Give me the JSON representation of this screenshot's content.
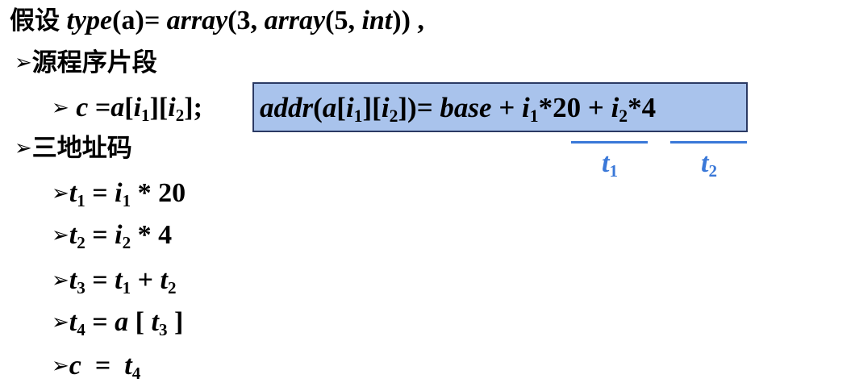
{
  "header": {
    "prefix": "假设",
    "type_fn": "type",
    "arg": "(a)",
    "eq_array": "= array",
    "mid": "(3, ",
    "array2": "array",
    "mid2": "(5, ",
    "int_kw": "int",
    "tail": ")) ,"
  },
  "source_section": {
    "arrow": "➢",
    "heading": "源程序片段"
  },
  "statement": {
    "arrow": "➢",
    "c": "c",
    "eq": " =",
    "a": "a",
    "ob1": "[",
    "i": "i",
    "sub1": "1",
    "cb_ob": "][",
    "i2": "i",
    "sub2": "2",
    "close": "];"
  },
  "formula": {
    "addr": "addr",
    "p1": "(",
    "a": "a",
    "b1": "[",
    "i": "i",
    "s1": "1",
    "b2": "][",
    "i2": "i",
    "s2": "2",
    "b3": "])= ",
    "base": "base",
    "plus1": " + ",
    "i3": "i",
    "s3": "1",
    "times20": "*20 + ",
    "i4": "i",
    "s4": "2",
    "times4": "*4"
  },
  "annotations": {
    "t1_var": "t",
    "t1_sub": "1",
    "t2_var": "t",
    "t2_sub": "2",
    "color": "#3a78d8"
  },
  "tac_section": {
    "arrow": "➢",
    "heading": "三地址码"
  },
  "tac": {
    "arrow": "➢",
    "line1": {
      "t": "t",
      "ts": "1",
      "eq": " = ",
      "i": "i",
      "is": "1",
      "rest": " * 20"
    },
    "line2": {
      "t": "t",
      "ts": "2",
      "eq": " = ",
      "i": "i",
      "is": "2",
      "rest": " * 4"
    },
    "line3": {
      "t": "t",
      "ts": "3",
      "eq": " = ",
      "a": "t",
      "as": "1",
      "plus": " + ",
      "b": "t",
      "bs": "2"
    },
    "line4": {
      "t": "t",
      "ts": "4",
      "eq": " = ",
      "a": "a",
      "ob": " [ ",
      "b": "t",
      "bs": "3",
      "cb": " ]"
    },
    "line5": {
      "c": "c",
      "eq": "  =  ",
      "t": "t",
      "ts": "4"
    }
  },
  "colors": {
    "box_fill": "#a9c3ec",
    "box_border": "#2b3a64",
    "accent": "#3a78d8"
  }
}
